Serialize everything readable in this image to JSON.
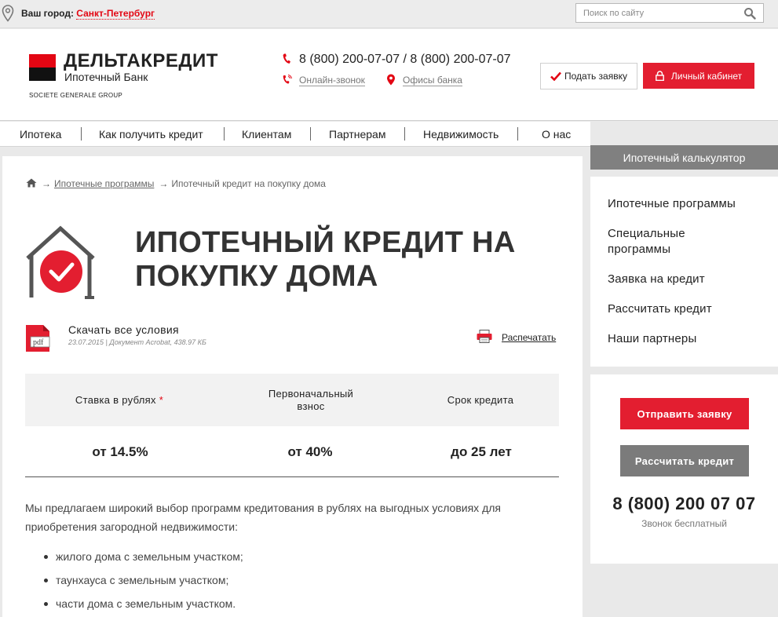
{
  "topbar": {
    "city_label": "Ваш город: ",
    "city_value": "Санкт-Петербург",
    "search_placeholder": "Поиск по сайту"
  },
  "logo": {
    "name": "ДЕЛЬТАКРЕДИТ",
    "subtitle": "Ипотечный Банк",
    "group": "SOCIETE GENERALE GROUP"
  },
  "contacts": {
    "phones": "8 (800) 200-07-07 / 8 (800) 200-07-07",
    "online_call": "Онлайн-звонок",
    "offices": "Офисы банка"
  },
  "header_buttons": {
    "apply": "Подать заявку",
    "cabinet": "Личный кабинет"
  },
  "nav": {
    "items": [
      "Ипотека",
      "Как получить кредит",
      "Клиентам",
      "Партнерам",
      "Недвижимость",
      "О нас"
    ]
  },
  "breadcrumb": {
    "arrow": "→",
    "programs": "Ипотечные программы",
    "current": "Ипотечный кредит на покупку дома"
  },
  "page": {
    "title": "ИПОТЕЧНЫЙ КРЕДИТ НА ПОКУПКУ ДОМА"
  },
  "download": {
    "icon_label": "pdf",
    "title": "Скачать все условия",
    "meta": "23.07.2015 | Документ Acrobat, 438.97 КБ",
    "print": "Распечатать"
  },
  "terms": {
    "rate_label": "Ставка в рублях",
    "rate_star": "*",
    "down_label_1": "Первоначальный",
    "down_label_2": "взнос",
    "term_label": "Срок кредита",
    "rate_value": "от 14.5%",
    "down_value": "от 40%",
    "term_value": "до 25 лет"
  },
  "description": {
    "text": "Мы предлагаем широкий выбор программ кредитования в рублях на выгодных условиях для приобретения загородной недвижимости:",
    "bullets": [
      "жилого дома с земельным участком;",
      "таунхауса с земельным участком;",
      "части дома с земельным участком."
    ]
  },
  "sidebar": {
    "calc_header": "Ипотечный калькулятор",
    "menu": [
      "Ипотечные программы",
      "Специальные программы",
      "Заявка на кредит",
      "Рассчитать кредит",
      "Наши партнеры"
    ],
    "send_button": "Отправить заявку",
    "calc_button": "Рассчитать кредит",
    "phone": "8 (800) 200 07 07",
    "phone_note": "Звонок бесплатный"
  },
  "colors": {
    "brand_red": "#e30613",
    "button_red": "#e31e30",
    "gray_button": "#7b7b7b"
  }
}
